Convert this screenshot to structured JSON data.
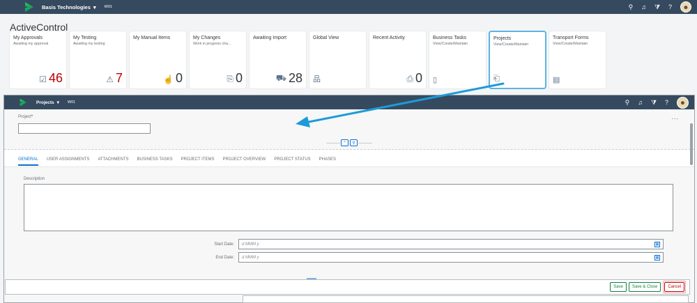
{
  "shell": {
    "title": "Basis Technologies",
    "system": "W01"
  },
  "page": {
    "title": "ActiveControl"
  },
  "tiles": [
    {
      "title": "My Approvals",
      "subtitle": "Awaiting my approval",
      "icon": "☑",
      "value": "46",
      "highlight": true
    },
    {
      "title": "My Testing",
      "subtitle": "Awaiting my testing",
      "icon": "⚠",
      "value": "7",
      "highlight": true
    },
    {
      "title": "My Manual Items",
      "subtitle": "",
      "icon": "☝",
      "value": "0"
    },
    {
      "title": "My Changes",
      "subtitle": "Work in progress cha...",
      "icon": "⎘",
      "value": "0"
    },
    {
      "title": "Awaiting Import",
      "subtitle": "",
      "icon": "⛟",
      "value": "28"
    },
    {
      "title": "Global View",
      "subtitle": "",
      "icon": "品",
      "value": ""
    },
    {
      "title": "Recent Activity",
      "subtitle": "",
      "icon": "⎙",
      "value": "0"
    },
    {
      "title": "Business Tasks",
      "subtitle": "View/Create/Maintain",
      "icon": "▯",
      "value": ""
    },
    {
      "title": "Projects",
      "subtitle": "View/Create/Maintain",
      "icon": "⎗",
      "value": ""
    },
    {
      "title": "Transport Forms",
      "subtitle": "View/Create/Maintain",
      "icon": "▤",
      "value": ""
    }
  ],
  "app": {
    "title": "Projects",
    "system": "W01",
    "project_label": "Project",
    "required_mark": "*",
    "more": "...",
    "tabs": [
      "GENERAL",
      "USER ASSIGNMENTS",
      "ATTACHMENTS",
      "BUSINESS TASKS",
      "PROJECT ITEMS",
      "PROJECT OVERVIEW",
      "PROJECT STATUS",
      "PHASES"
    ],
    "active_tab": "GENERAL",
    "description_label": "Description",
    "start_date_label": "Start Date:",
    "end_date_label": "End Date:",
    "date_placeholder": "d MMM y"
  },
  "footer": {
    "save": "Save",
    "save_close": "Save & Close",
    "cancel": "Cancel"
  },
  "colors": {
    "shell": "#354a5f",
    "accent": "#0a6ed1",
    "negative": "#bb0000",
    "positive": "#107e3e",
    "arrow": "#1d9bd8"
  }
}
